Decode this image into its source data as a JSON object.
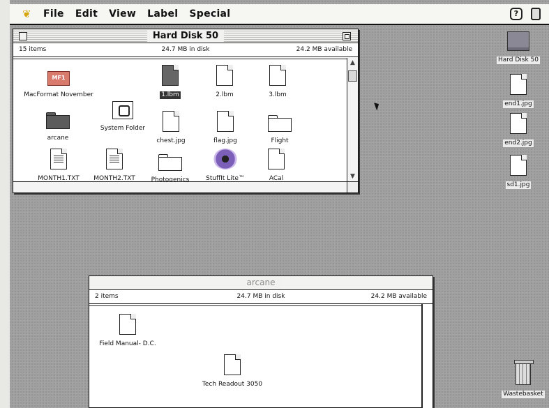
{
  "menubar": {
    "apple_icon": "apple-menu-icon",
    "items": [
      "File",
      "Edit",
      "View",
      "Label",
      "Special"
    ],
    "help_glyph": "?"
  },
  "hd_window": {
    "title": "Hard Disk 50",
    "items_count": "15 items",
    "in_disk": "24.7 MB in disk",
    "available": "24.2 MB available",
    "icons": [
      {
        "label": "MacFormat November",
        "kind": "macformat-folder",
        "badge": "MF1"
      },
      {
        "label": "1.lbm",
        "kind": "document",
        "selected": true
      },
      {
        "label": "2.lbm",
        "kind": "document"
      },
      {
        "label": "3.lbm",
        "kind": "document"
      },
      {
        "label": "System Folder",
        "kind": "system-folder"
      },
      {
        "label": "arcane",
        "kind": "folder-dark"
      },
      {
        "label": "chest.jpg",
        "kind": "document"
      },
      {
        "label": "flag.jpg",
        "kind": "document"
      },
      {
        "label": "Flight",
        "kind": "folder"
      },
      {
        "label": "MONTH1.TXT",
        "kind": "text-document"
      },
      {
        "label": "MONTH2.TXT",
        "kind": "text-document"
      },
      {
        "label": "Photogenics",
        "kind": "folder"
      },
      {
        "label": "StuffIt Lite™",
        "kind": "stuffit-app"
      },
      {
        "label": "ACal",
        "kind": "document"
      }
    ]
  },
  "arcane_window": {
    "title": "arcane",
    "items_count": "2 items",
    "in_disk": "24.7 MB in disk",
    "available": "24.2 MB available",
    "icons": [
      {
        "label": "Field Manual- D.C.",
        "kind": "document"
      },
      {
        "label": "Tech Readout 3050",
        "kind": "document"
      }
    ]
  },
  "desktop": {
    "icons": [
      {
        "label": "Hard Disk 50",
        "kind": "hard-disk"
      },
      {
        "label": "end1.jpg",
        "kind": "document"
      },
      {
        "label": "end2.jpg",
        "kind": "document"
      },
      {
        "label": "sd1.jpg",
        "kind": "document"
      },
      {
        "label": "Wastebasket",
        "kind": "trash"
      }
    ]
  }
}
